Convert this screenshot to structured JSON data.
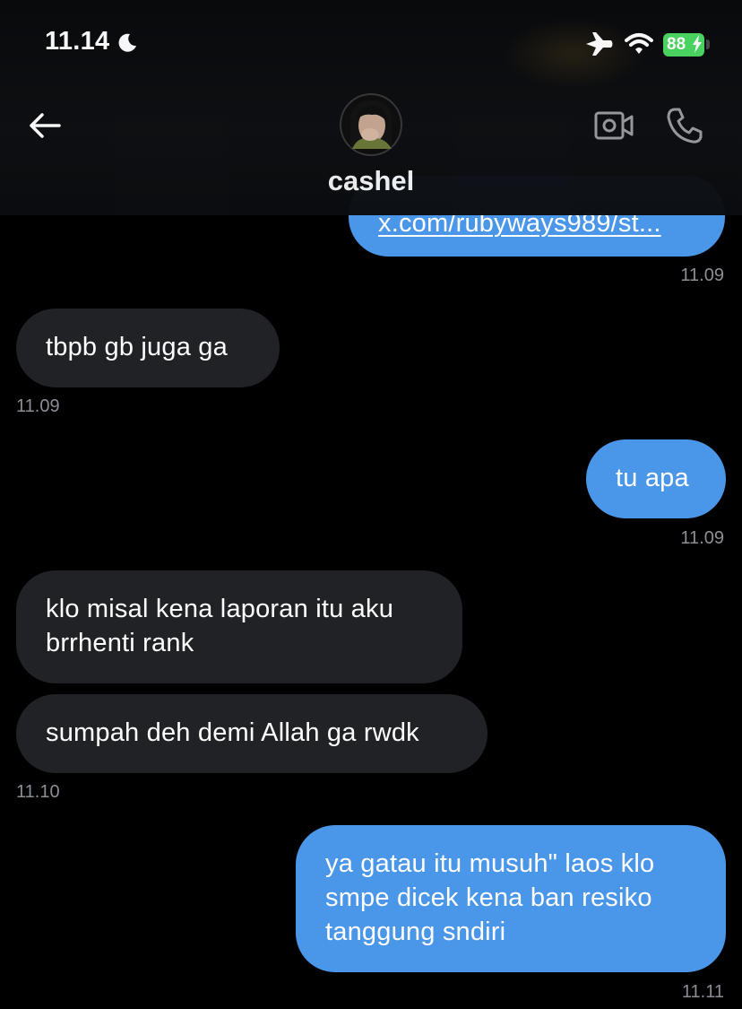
{
  "status_bar": {
    "time": "11.14",
    "battery": "88"
  },
  "header": {
    "contact_name": "cashel"
  },
  "icons": {
    "back": "arrow-left-icon",
    "video": "video-camera-icon",
    "call": "phone-icon",
    "moon": "moon-icon",
    "airplane": "airplane-icon",
    "wifi": "wifi-icon"
  },
  "colors": {
    "outgoing_bubble": "#4a96e8",
    "incoming_bubble": "#202226",
    "timestamp": "#8b8e94",
    "battery": "#4cd964"
  },
  "messages": [
    {
      "direction": "outgoing",
      "lines": [
        "x.com/rubyways989/st..."
      ],
      "time": "11.09",
      "is_link": true
    },
    {
      "direction": "incoming",
      "lines": [
        "tbpb gb juga ga"
      ],
      "time": "11.09"
    },
    {
      "direction": "outgoing",
      "lines": [
        "tu apa"
      ],
      "time": "11.09"
    },
    {
      "direction": "incoming",
      "lines": [
        "klo misal kena laporan itu aku",
        "brrhenti rank"
      ],
      "time": ""
    },
    {
      "direction": "incoming",
      "lines": [
        "sumpah deh demi Allah ga rwdk"
      ],
      "time": "11.10"
    },
    {
      "direction": "outgoing",
      "lines": [
        "ya gatau itu musuh\" laos klo",
        "smpe dicek kena ban resiko",
        "tanggung sndiri"
      ],
      "time": "11.11"
    }
  ]
}
